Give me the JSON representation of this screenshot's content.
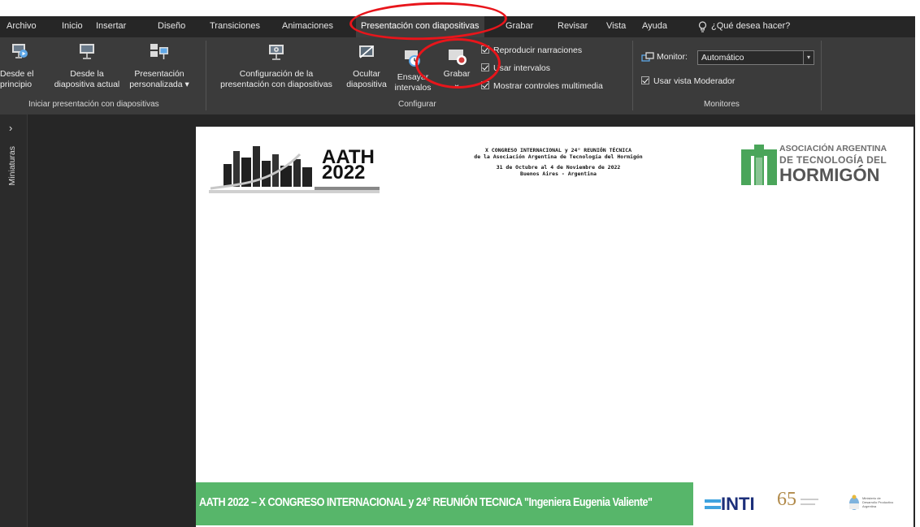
{
  "tabs": [
    {
      "label": "Archivo"
    },
    {
      "label": "Inicio"
    },
    {
      "label": "Insertar"
    },
    {
      "label": "Diseño"
    },
    {
      "label": "Transiciones"
    },
    {
      "label": "Animaciones"
    },
    {
      "label": "Presentación con diapositivas",
      "active": true
    },
    {
      "label": "Grabar"
    },
    {
      "label": "Revisar"
    },
    {
      "label": "Vista"
    },
    {
      "label": "Ayuda"
    }
  ],
  "tell_me": "¿Qué desea hacer?",
  "ribbon": {
    "start_group": {
      "label": "Iniciar presentación con diapositivas",
      "from_beginning": [
        "Desde el",
        "principio"
      ],
      "from_current": [
        "Desde la",
        "diapositiva actual"
      ],
      "custom": [
        "Presentación",
        "personalizada ▾"
      ]
    },
    "setup_group": {
      "label": "Configurar",
      "setup": [
        "Configuración de la",
        "presentación con diapositivas"
      ],
      "hide": [
        "Ocultar",
        "diapositiva"
      ],
      "rehearse": [
        "Ensayar",
        "intervalos"
      ],
      "record": "Grabar",
      "record_arrow": "⌄",
      "play_narrations": "Reproducir narraciones",
      "use_timings": "Usar intervalos",
      "show_media_controls": "Mostrar controles multimedia"
    },
    "monitors_group": {
      "label": "Monitores",
      "monitor_label": "Monitor:",
      "monitor_value": "Automático",
      "presenter_view": "Usar vista Moderador"
    }
  },
  "thumbnails_pane": {
    "label": "Miniaturas",
    "expand_glyph": "›"
  },
  "slide": {
    "logo_aath": {
      "line1": "AATH",
      "line2": "2022"
    },
    "congress": {
      "line1": "X CONGRESO INTERNACIONAL y 24° REUNIÓN TÉCNICA",
      "line2": "de la Asociación Argentina de Tecnología del Hormigón",
      "line3": "31 de Octubre al 4 de Noviembre de 2022",
      "line4": "Buenos Aires - Argentina"
    },
    "asoc": {
      "line1": "ASOCIACIÓN ARGENTINA",
      "line2": "DE TECNOLOGÍA DEL",
      "line3": "HORMIGÓN"
    },
    "footer": "AATH 2022 – X CONGRESO INTERNACIONAL y 24° REUNIÓN TECNICA \"Ingeniera Eugenia Valiente\"",
    "inti": "INTI",
    "sixtyfive": "65",
    "ministry": {
      "line1": "Ministerio de",
      "line2": "Desarrollo Productivo",
      "line3": "Argentina"
    }
  },
  "colors": {
    "annotation": "#e8151b",
    "footer_green": "#57b66a",
    "asoc_green": "#4aa55a",
    "inti_blue": "#1c2f7a"
  }
}
